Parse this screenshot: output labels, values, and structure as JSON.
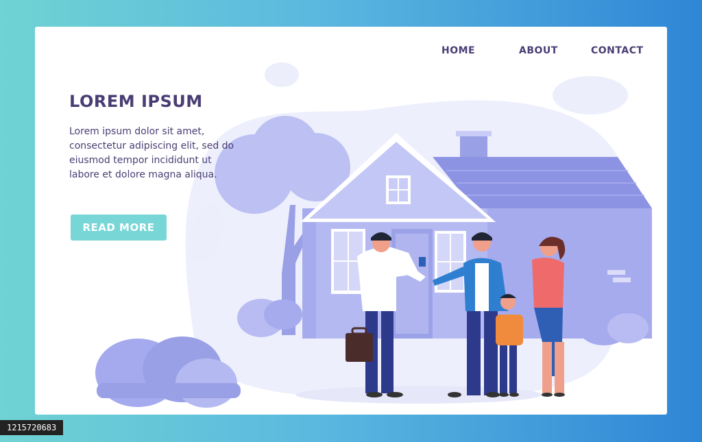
{
  "nav": {
    "home": "HOME",
    "about": "ABOUT",
    "contact": "CONTACT"
  },
  "hero": {
    "title": "LOREM IPSUM",
    "body": "Lorem ipsum dolor sit amet, consectetur adipiscing elit, sed do eiusmod tempor incididunt ut labore et dolore magna aliqua.",
    "cta": "READ MORE"
  },
  "image_id": "1215720683",
  "colors": {
    "heading": "#4a3d74",
    "button": "#78d6d6",
    "illustration_primary": "#9ea4ea",
    "illustration_light": "#e8e9fb"
  }
}
